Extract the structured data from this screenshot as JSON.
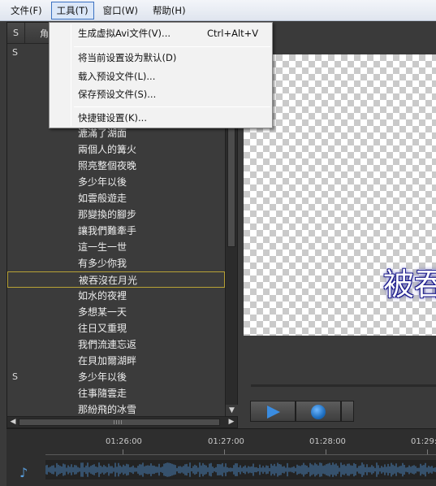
{
  "menubar": {
    "items": [
      "文件(F)",
      "工具(T)",
      "窗口(W)",
      "帮助(H)"
    ],
    "active_index": 1
  },
  "tools_menu": {
    "items": [
      {
        "label": "生成虚拟Avi文件(V)...",
        "shortcut": "Ctrl+Alt+V"
      },
      {
        "label": "将当前设置设为默认(D)",
        "shortcut": ""
      },
      {
        "label": "载入预设文件(L)...",
        "shortcut": ""
      },
      {
        "label": "保存预设文件(S)...",
        "shortcut": ""
      },
      {
        "label": "快捷键设置(K)...",
        "shortcut": ""
      }
    ]
  },
  "lyrics_panel": {
    "header": {
      "s_col": "S",
      "role_col": "角"
    },
    "first_row_s": "S",
    "rows": [
      {
        "s": "",
        "text": "漉滿了湖面"
      },
      {
        "s": "",
        "text": "兩個人的篝火"
      },
      {
        "s": "",
        "text": "照亮整個夜晚"
      },
      {
        "s": "",
        "text": "多少年以後"
      },
      {
        "s": "",
        "text": "如雲般遊走"
      },
      {
        "s": "",
        "text": "那變換的腳步"
      },
      {
        "s": "",
        "text": "讓我們難牽手"
      },
      {
        "s": "",
        "text": "這一生一世"
      },
      {
        "s": "",
        "text": "有多少你我"
      },
      {
        "s": "",
        "text": "被吞沒在月光"
      },
      {
        "s": "",
        "text": "如水的夜裡"
      },
      {
        "s": "",
        "text": "多想某一天"
      },
      {
        "s": "",
        "text": "往日又重現"
      },
      {
        "s": "",
        "text": "我們流連忘返"
      },
      {
        "s": "",
        "text": "在貝加爾湖畔"
      },
      {
        "s": "S",
        "text": "多少年以後"
      },
      {
        "s": "",
        "text": "往事隨雲走"
      },
      {
        "s": "",
        "text": "那紛飛的冰雪"
      }
    ],
    "selected_index": 9
  },
  "preview": {
    "caption": "被吞"
  },
  "timeline": {
    "ticks": [
      "01:26:00",
      "01:27:00",
      "01:28:00",
      "01:29:"
    ]
  },
  "colors": {
    "selection_border": "#b8a236",
    "caption_outline": "#1a1a8c",
    "play_button": "#3a8ce0"
  }
}
